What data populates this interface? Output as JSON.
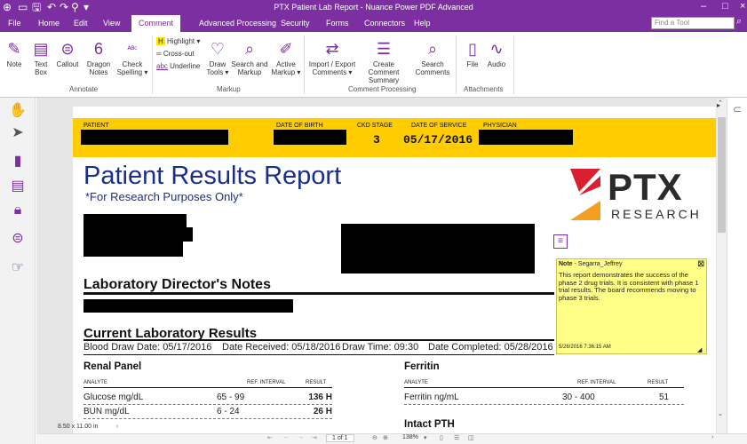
{
  "window": {
    "title": "PTX Patient Lab Report - Nuance Power PDF Advanced",
    "minimize": "–",
    "maximize": "□",
    "close": "×"
  },
  "qat": [
    "⊕",
    "▭",
    "🖫",
    "↶",
    "↷",
    "⚲",
    "▾"
  ],
  "menu": {
    "items": [
      "File",
      "Home",
      "Edit",
      "View",
      "Comment",
      "Advanced Processing",
      "Security",
      "Forms",
      "Connectors",
      "Help"
    ],
    "find_placeholder": "Find a Tool"
  },
  "ribbon": {
    "buttons": [
      {
        "label": "Note",
        "icon": "note-icon",
        "glyph": "✎"
      },
      {
        "label": "Text Box",
        "icon": "textbox-icon",
        "glyph": "▤"
      },
      {
        "label": "Callout",
        "icon": "callout-icon",
        "glyph": "⊜"
      },
      {
        "label": "Dragon Notes",
        "icon": "dragon-icon",
        "glyph": "6"
      },
      {
        "label": "Check Spelling ▾",
        "icon": "spell-icon",
        "glyph": "ᴬᴮᶜ"
      },
      {
        "label": "Draw Tools ▾",
        "icon": "draw-icon",
        "glyph": "♡"
      },
      {
        "label": "Search and Markup",
        "icon": "search-markup-icon",
        "glyph": "⌕"
      },
      {
        "label": "Active Markup ▾",
        "icon": "active-markup-icon",
        "glyph": "✐"
      },
      {
        "label": "Import / Export Comments ▾",
        "icon": "import-export-icon",
        "glyph": "⇄"
      },
      {
        "label": "Create Comment Summary",
        "icon": "comment-summary-icon",
        "glyph": "☰"
      },
      {
        "label": "Search Comments",
        "icon": "search-comments-icon",
        "glyph": "⌕"
      },
      {
        "label": "File",
        "icon": "file-icon",
        "glyph": "▯"
      },
      {
        "label": "Audio",
        "icon": "audio-icon",
        "glyph": "∿"
      }
    ],
    "small": [
      "Highlight ▾",
      "Cross-out",
      "Underline"
    ],
    "groups": [
      "Annotate",
      "Markup",
      "Comment Processing",
      "Attachments"
    ]
  },
  "band": {
    "patient": "PATIENT",
    "dob": "DATE OF BIRTH",
    "ckd": "CKD STAGE",
    "ckd_value": "3",
    "dos": "DATE OF SERVICE",
    "dos_value": "05/17/2016",
    "physician": "PHYSICIAN"
  },
  "report": {
    "title": "Patient Results Report",
    "subtitle": "*For Research Purposes Only*",
    "logo_main": "PTX",
    "logo_sub": "RESEARCH"
  },
  "director": {
    "heading": "Laboratory Director's Notes"
  },
  "current": {
    "heading": "Current Laboratory Results",
    "blood_draw": "Blood Draw Date: 05/17/2016",
    "received": "Date Received: 05/18/2016",
    "draw_time": "Draw Time: 09:30",
    "completed": "Date Completed: 05/28/2016"
  },
  "renal": {
    "title": "Renal Panel",
    "cols": [
      "ANALYTE",
      "REF. INTERVAL",
      "RESULT"
    ],
    "rows": [
      {
        "analyte": "Glucose mg/dL",
        "ref": "65 - 99",
        "result": "136 H"
      },
      {
        "analyte": "BUN mg/dL",
        "ref": "6 - 24",
        "result": "26 H"
      }
    ]
  },
  "ferritin": {
    "title": "Ferritin",
    "cols": [
      "ANALYTE",
      "REF. INTERVAL",
      "RESULT"
    ],
    "rows": [
      {
        "analyte": "Ferritin ng/mL",
        "ref": "30 - 400",
        "result": "51"
      }
    ],
    "next": "Intact PTH"
  },
  "note": {
    "label": "Note",
    "author": " - Segarra_Jeffrey",
    "close": "⊠",
    "body": "This report demonstrates the success of the phase 2 drug trials.  It is consistent with phase 1 trial results.  The board recommends moving to phase 3 trials.",
    "timestamp": "5/26/2016 7:36:15 AM"
  },
  "status": {
    "page_size": "8.50 x 11.00 in",
    "page": "1 of 1",
    "zoom": "138%"
  }
}
